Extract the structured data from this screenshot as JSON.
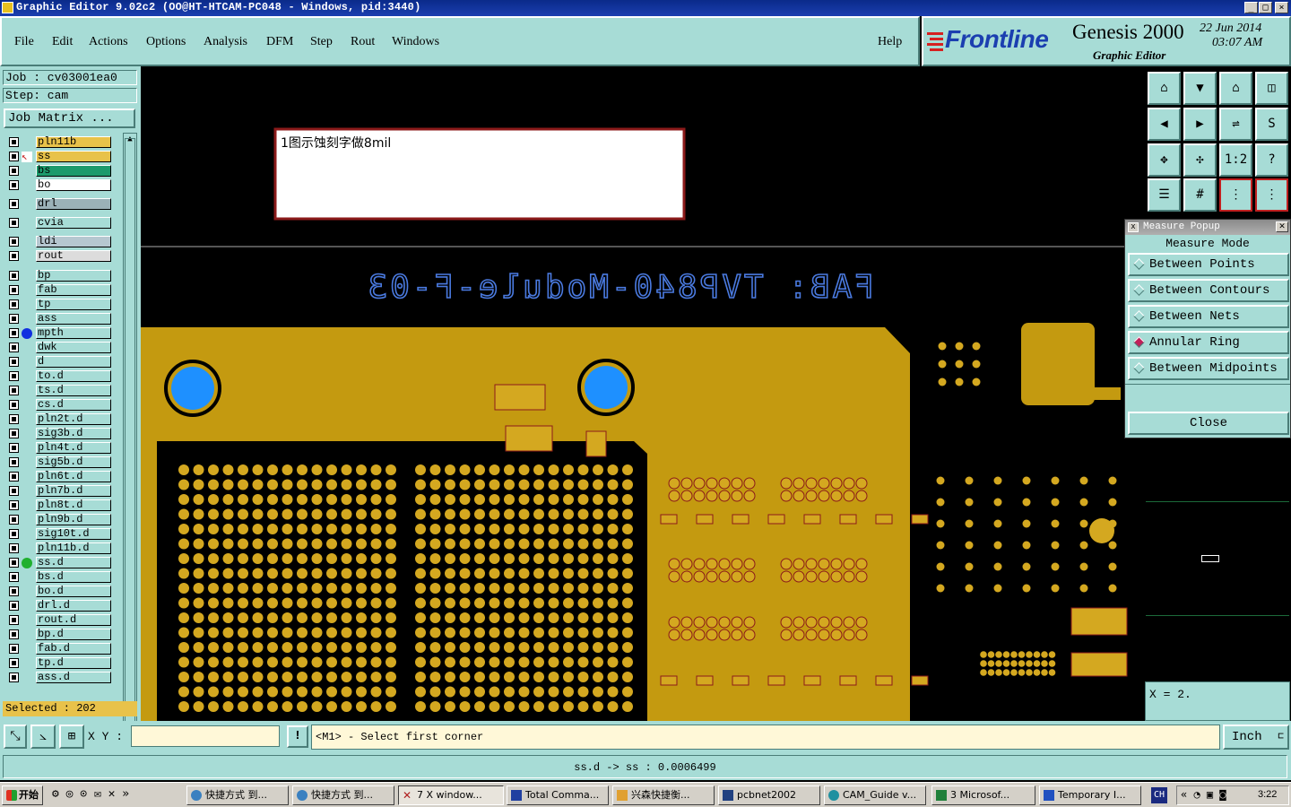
{
  "window": {
    "title": "Graphic Editor 9.02c2 (OO@HT-HTCAM-PC048 - Windows, pid:3440)"
  },
  "menu": [
    "File",
    "Edit",
    "Actions",
    "Options",
    "Analysis",
    "DFM",
    "Step",
    "Rout",
    "Windows"
  ],
  "help": "Help",
  "brand": {
    "logo": "Frontline",
    "product": "Genesis 2000",
    "subtitle": "Graphic Editor",
    "date": "22 Jun 2014",
    "time": "03:07 AM"
  },
  "job": {
    "job_line": "Job : cv03001ea0",
    "step_line": "Step: cam",
    "matrix_button": "Job Matrix ..."
  },
  "layers": [
    {
      "name": "pln11b",
      "color": "#e8c24a",
      "marker": ""
    },
    {
      "name": "ss",
      "color": "#e8c24a",
      "marker": "cursor"
    },
    {
      "name": "bs",
      "color": "#1c9a6c",
      "marker": ""
    },
    {
      "name": "bo",
      "color": "#ffffff",
      "marker": ""
    },
    {
      "name": "drl",
      "color": "#9bb2b8",
      "marker": ""
    },
    {
      "name": "cvia",
      "color": "#a7dcd6",
      "marker": ""
    },
    {
      "name": "ldi",
      "color": "#b6c7d0",
      "marker": ""
    },
    {
      "name": "rout",
      "color": "#dcdcdc",
      "marker": ""
    },
    {
      "name": "bp",
      "color": "#a7dcd6",
      "marker": ""
    },
    {
      "name": "fab",
      "color": "#a7dcd6",
      "marker": ""
    },
    {
      "name": "tp",
      "color": "#a7dcd6",
      "marker": ""
    },
    {
      "name": "ass",
      "color": "#a7dcd6",
      "marker": ""
    },
    {
      "name": "mpth",
      "color": "#a7dcd6",
      "marker": "blue"
    },
    {
      "name": "dwk",
      "color": "#a7dcd6",
      "marker": ""
    },
    {
      "name": "d",
      "color": "#a7dcd6",
      "marker": ""
    },
    {
      "name": "to.d",
      "color": "#a7dcd6",
      "marker": ""
    },
    {
      "name": "ts.d",
      "color": "#a7dcd6",
      "marker": ""
    },
    {
      "name": "cs.d",
      "color": "#a7dcd6",
      "marker": ""
    },
    {
      "name": "pln2t.d",
      "color": "#a7dcd6",
      "marker": ""
    },
    {
      "name": "sig3b.d",
      "color": "#a7dcd6",
      "marker": ""
    },
    {
      "name": "pln4t.d",
      "color": "#a7dcd6",
      "marker": ""
    },
    {
      "name": "sig5b.d",
      "color": "#a7dcd6",
      "marker": ""
    },
    {
      "name": "pln6t.d",
      "color": "#a7dcd6",
      "marker": ""
    },
    {
      "name": "pln7b.d",
      "color": "#a7dcd6",
      "marker": ""
    },
    {
      "name": "pln8t.d",
      "color": "#a7dcd6",
      "marker": ""
    },
    {
      "name": "pln9b.d",
      "color": "#a7dcd6",
      "marker": ""
    },
    {
      "name": "sig10t.d",
      "color": "#a7dcd6",
      "marker": ""
    },
    {
      "name": "pln11b.d",
      "color": "#a7dcd6",
      "marker": ""
    },
    {
      "name": "ss.d",
      "color": "#a7dcd6",
      "marker": "green"
    },
    {
      "name": "bs.d",
      "color": "#a7dcd6",
      "marker": ""
    },
    {
      "name": "bo.d",
      "color": "#a7dcd6",
      "marker": ""
    },
    {
      "name": "drl.d",
      "color": "#a7dcd6",
      "marker": ""
    },
    {
      "name": "rout.d",
      "color": "#a7dcd6",
      "marker": ""
    },
    {
      "name": "bp.d",
      "color": "#a7dcd6",
      "marker": ""
    },
    {
      "name": "fab.d",
      "color": "#a7dcd6",
      "marker": ""
    },
    {
      "name": "tp.d",
      "color": "#a7dcd6",
      "marker": ""
    },
    {
      "name": "ass.d",
      "color": "#a7dcd6",
      "marker": ""
    }
  ],
  "selected_count": "Selected : 202",
  "canvas": {
    "annotation": "1图示蚀刻字做8mil",
    "fab_text": "FAB: TVP840-Module-F-03",
    "copper_color": "#c49a10",
    "pad_color": "#d4a820",
    "hole_color": "#1e90ff"
  },
  "measure": {
    "title": "Measure Popup",
    "mode_label": "Measure Mode",
    "options": [
      "Between Points",
      "Between Contours",
      "Between Nets",
      "Annular Ring",
      "Between Midpoints"
    ],
    "active_option": "Annular Ring",
    "close": "Close"
  },
  "right_panel": {
    "x_readout": "X = 2."
  },
  "cmd": {
    "xy_label": "X Y :",
    "xy_value": "",
    "exclaim": "!",
    "prompt": "<M1> - Select first corner",
    "units": "Inch"
  },
  "status": "ss.d -> ss : 0.0006499",
  "taskbar": {
    "start": "开始",
    "tasks": [
      "快捷方式 到...",
      "快捷方式 到...",
      "7 X window...",
      "Total Comma...",
      "兴森快捷衡...",
      "pcbnet2002",
      "CAM_Guide v...",
      "3 Microsof...",
      "Temporary I..."
    ],
    "lang": "CH",
    "clock": "3:22"
  }
}
